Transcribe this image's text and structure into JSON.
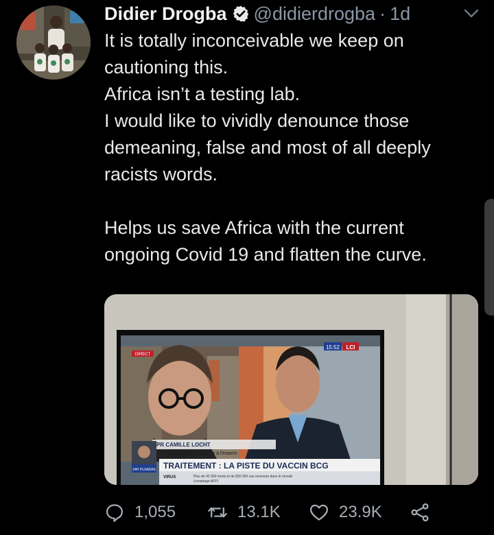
{
  "author": {
    "name": "Didier Drogba",
    "handle": "@didierdrogba",
    "separator": "·",
    "time": "1d",
    "verified": true
  },
  "tweet": {
    "lines": [
      "It is totally inconceivable we keep on",
      "cautioning this.",
      "Africa isn’t a testing lab.",
      "I would like to vividly denounce those",
      "demeaning, false and most of all deeply",
      "racists words."
    ],
    "lines2": [
      "Helps us save Africa with the current",
      "ongoing Covid 19 and flatten the curve."
    ]
  },
  "media": {
    "live_tag": "DIRECT",
    "clock": "15:52",
    "channel": "LCI",
    "guest_name": "PR CAMILLE LOCHT",
    "guest_title": "Directeur de recherche à l'Inserm",
    "headline": "TRAITEMENT : LA PISTE DU VACCIN BCG",
    "topic": "VIRUS",
    "sub1": "Plus de 42 000 morts et de 830 000 cas recensés dans le monde",
    "sub2": "(comptage AFP)",
    "show": "24H PUJADAS"
  },
  "actions": {
    "replies": "1,055",
    "retweets": "13.1K",
    "likes": "23.9K"
  },
  "colors": {
    "background": "#000000",
    "text": "#e9e9e9",
    "muted": "#8b98a5",
    "action": "#a7aeb5"
  }
}
